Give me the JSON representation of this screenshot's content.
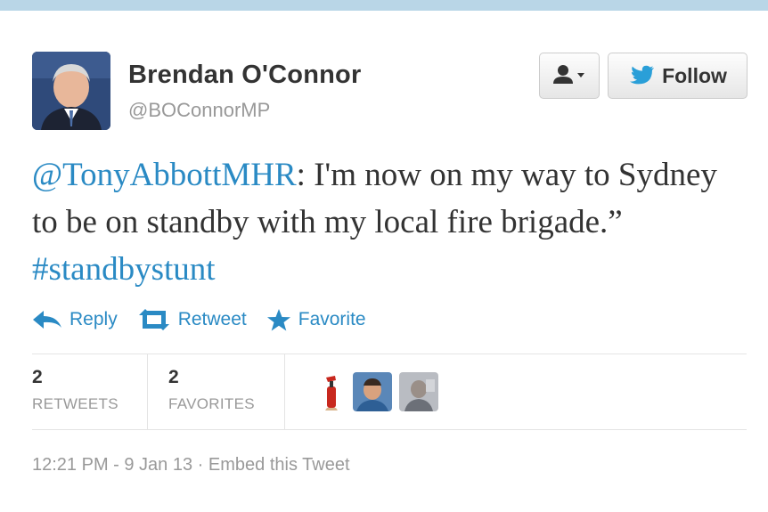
{
  "user": {
    "name": "Brendan O'Connor",
    "handle": "@BOConnorMP"
  },
  "buttons": {
    "user_dropdown_icon": "person-icon",
    "follow_label": "Follow"
  },
  "tweet": {
    "mention": "@TonyAbbottMHR",
    "text_main": ": I'm now on my way to Sydney to be on standby with my local fire brigade.” ",
    "hashtag": "#standbystunt"
  },
  "actions": {
    "reply_label": "Reply",
    "retweet_label": "Retweet",
    "favorite_label": "Favorite"
  },
  "stats": {
    "retweets_count": "2",
    "retweets_label": "RETWEETS",
    "favorites_count": "2",
    "favorites_label": "FAVORITES"
  },
  "footer": {
    "timestamp": "12:21 PM - 9 Jan 13",
    "separator": " · ",
    "embed_label": "Embed this Tweet"
  },
  "colors": {
    "link": "#2a8ac4",
    "twitter_bird": "#2a9fd8",
    "muted": "#999999"
  }
}
